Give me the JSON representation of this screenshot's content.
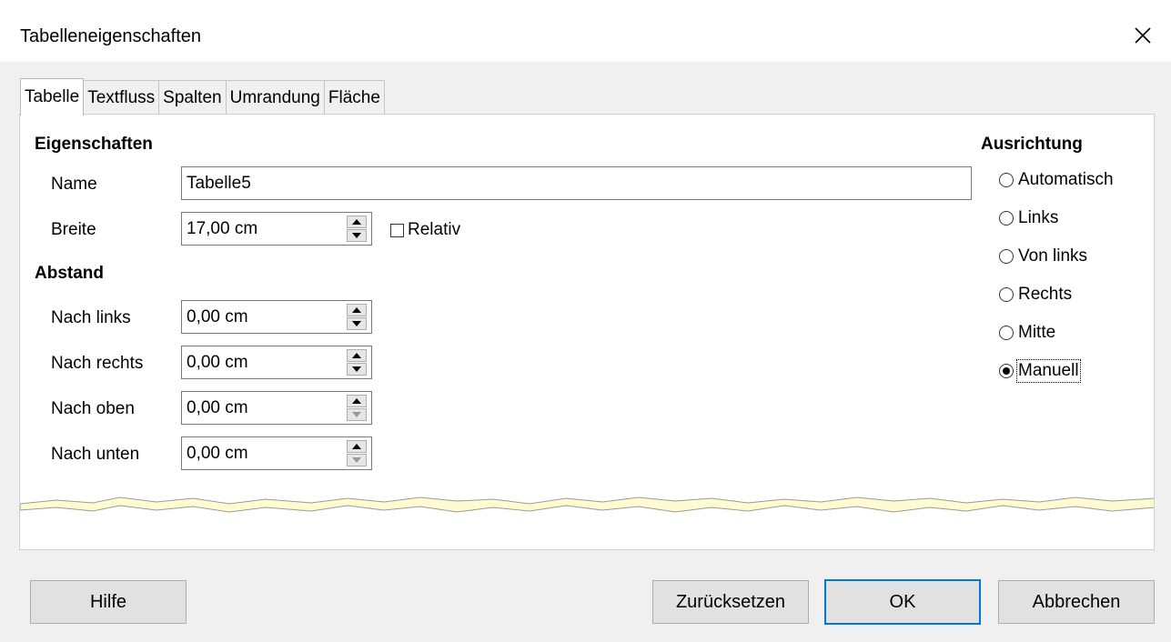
{
  "window": {
    "title": "Tabelleneigenschaften",
    "close_icon": "close-icon"
  },
  "tabs": [
    {
      "label": "Tabelle",
      "active": true
    },
    {
      "label": "Textfluss",
      "active": false
    },
    {
      "label": "Spalten",
      "active": false
    },
    {
      "label": "Umrandung",
      "active": false
    },
    {
      "label": "Fläche",
      "active": false
    }
  ],
  "properties": {
    "heading": "Eigenschaften",
    "name_label": "Name",
    "name_value": "Tabelle5",
    "width_label": "Breite",
    "width_value": "17,00 cm",
    "relative_label": "Relativ",
    "relative_checked": false
  },
  "spacing": {
    "heading": "Abstand",
    "left_label": "Nach links",
    "left_value": "0,00 cm",
    "right_label": "Nach rechts",
    "right_value": "0,00 cm",
    "top_label": "Nach oben",
    "top_value": "0,00 cm",
    "bottom_label": "Nach unten",
    "bottom_value": "0,00 cm"
  },
  "alignment": {
    "heading": "Ausrichtung",
    "options": [
      {
        "label": "Automatisch",
        "checked": false
      },
      {
        "label": "Links",
        "checked": false
      },
      {
        "label": "Von links",
        "checked": false
      },
      {
        "label": "Rechts",
        "checked": false
      },
      {
        "label": "Mitte",
        "checked": false
      },
      {
        "label": "Manuell",
        "checked": true
      }
    ]
  },
  "buttons": {
    "help": "Hilfe",
    "reset": "Zurücksetzen",
    "ok": "OK",
    "cancel": "Abbrechen"
  },
  "colors": {
    "default_button_border": "#0078d7",
    "tear_fill": "#fffbd0"
  }
}
